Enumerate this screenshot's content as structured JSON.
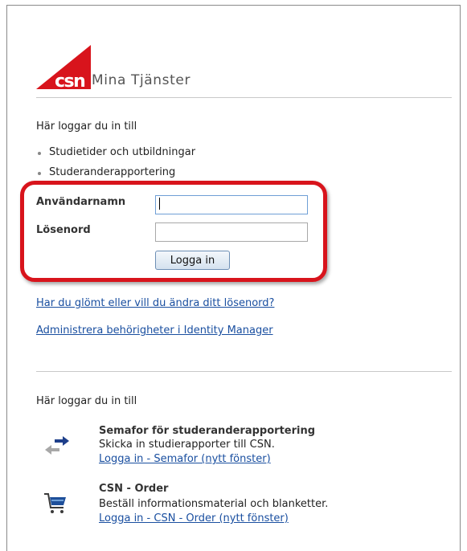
{
  "header": {
    "logo_mark": "csn",
    "app_title": "Mina Tjänster"
  },
  "login": {
    "intro": "Här loggar du in till",
    "bullets": [
      "Studietider och utbildningar",
      "Studeranderapportering"
    ],
    "username_label": "Användarnamn",
    "username_value": "",
    "password_label": "Lösenord",
    "password_value": "",
    "submit_label": "Logga in"
  },
  "links": {
    "forgot_password": "Har du glömt eller vill du ändra ditt lösenord?",
    "identity_manager": "Administrera behörigheter i Identity Manager"
  },
  "services": {
    "intro": "Här loggar du in till",
    "items": [
      {
        "title": "Semafor för studeranderapportering",
        "description": "Skicka in studierapporter till CSN.",
        "link": "Logga in - Semafor (nytt fönster)",
        "icon": "arrows-exchange-icon"
      },
      {
        "title": "CSN - Order",
        "description": "Beställ informationsmaterial och blanketter.",
        "link": "Logga in - CSN - Order (nytt fönster)",
        "icon": "shopping-cart-icon"
      }
    ]
  },
  "colors": {
    "brand_red": "#d8141c",
    "link_blue": "#1a4fa0",
    "highlight_red": "#d8141c"
  }
}
